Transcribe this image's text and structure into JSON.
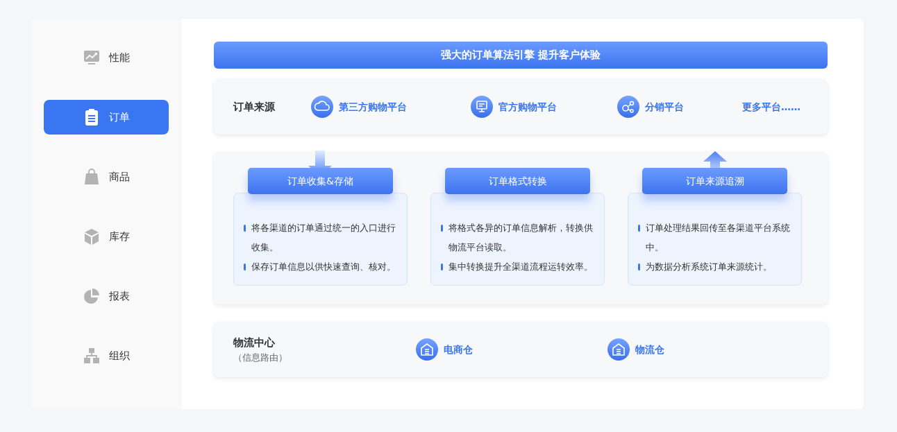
{
  "sidebar": {
    "items": [
      {
        "label": "性能",
        "selected": false
      },
      {
        "label": "订单",
        "selected": true
      },
      {
        "label": "商品",
        "selected": false
      },
      {
        "label": "库存",
        "selected": false
      },
      {
        "label": "报表",
        "selected": false
      },
      {
        "label": "组织",
        "selected": false
      }
    ]
  },
  "banner": {
    "title": "强大的订单算法引擎 提升客户体验"
  },
  "order_sources": {
    "title": "订单来源",
    "items": [
      {
        "label": "第三方购物平台"
      },
      {
        "label": "官方购物平台"
      },
      {
        "label": "分销平台"
      },
      {
        "label": "更多平台……"
      }
    ]
  },
  "process": {
    "steps": [
      {
        "title": "订单收集&存储",
        "bullets": [
          "将各渠道的订单通过统一的入口进行收集。",
          "保存订单信息以供快速查询、核对。"
        ]
      },
      {
        "title": "订单格式转换",
        "bullets": [
          "将格式各异的订单信息解析，转换供物流平台读取。",
          "集中转换提升全渠道流程运转效率。"
        ]
      },
      {
        "title": "订单来源追溯",
        "bullets": [
          "订单处理结果回传至各渠道平台系统中。",
          "为数据分析系统订单来源统计。"
        ]
      }
    ]
  },
  "logistics": {
    "title": "物流中心",
    "subtitle": "（信息路由）",
    "items": [
      {
        "label": "电商仓"
      },
      {
        "label": "物流仓"
      }
    ]
  }
}
